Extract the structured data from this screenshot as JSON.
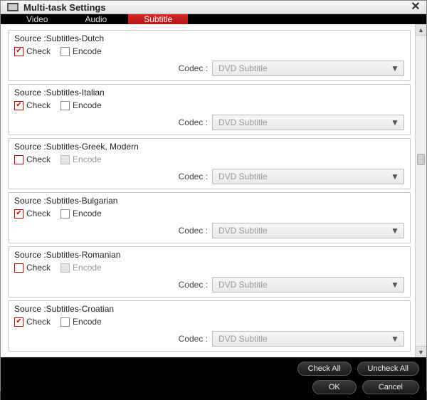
{
  "window": {
    "title": "Multi-task Settings"
  },
  "tabs": {
    "video": "Video",
    "audio": "Audio",
    "subtitle": "Subtitle",
    "active": "subtitle"
  },
  "labels": {
    "check": "Check",
    "encode": "Encode",
    "codec": "Codec :",
    "source_prefix": "Source :"
  },
  "codec_value": "DVD Subtitle",
  "groups": [
    {
      "source": "Subtitles-Dutch",
      "check": true,
      "encode": false,
      "encode_disabled": false
    },
    {
      "source": "Subtitles-Italian",
      "check": true,
      "encode": false,
      "encode_disabled": false
    },
    {
      "source": "Subtitles-Greek, Modern",
      "check": false,
      "encode": false,
      "encode_disabled": true
    },
    {
      "source": "Subtitles-Bulgarian",
      "check": true,
      "encode": false,
      "encode_disabled": false
    },
    {
      "source": "Subtitles-Romanian",
      "check": false,
      "encode": false,
      "encode_disabled": true
    },
    {
      "source": "Subtitles-Croatian",
      "check": true,
      "encode": false,
      "encode_disabled": false
    }
  ],
  "footer": {
    "check_all": "Check All",
    "uncheck_all": "Uncheck All",
    "ok": "OK",
    "cancel": "Cancel"
  }
}
